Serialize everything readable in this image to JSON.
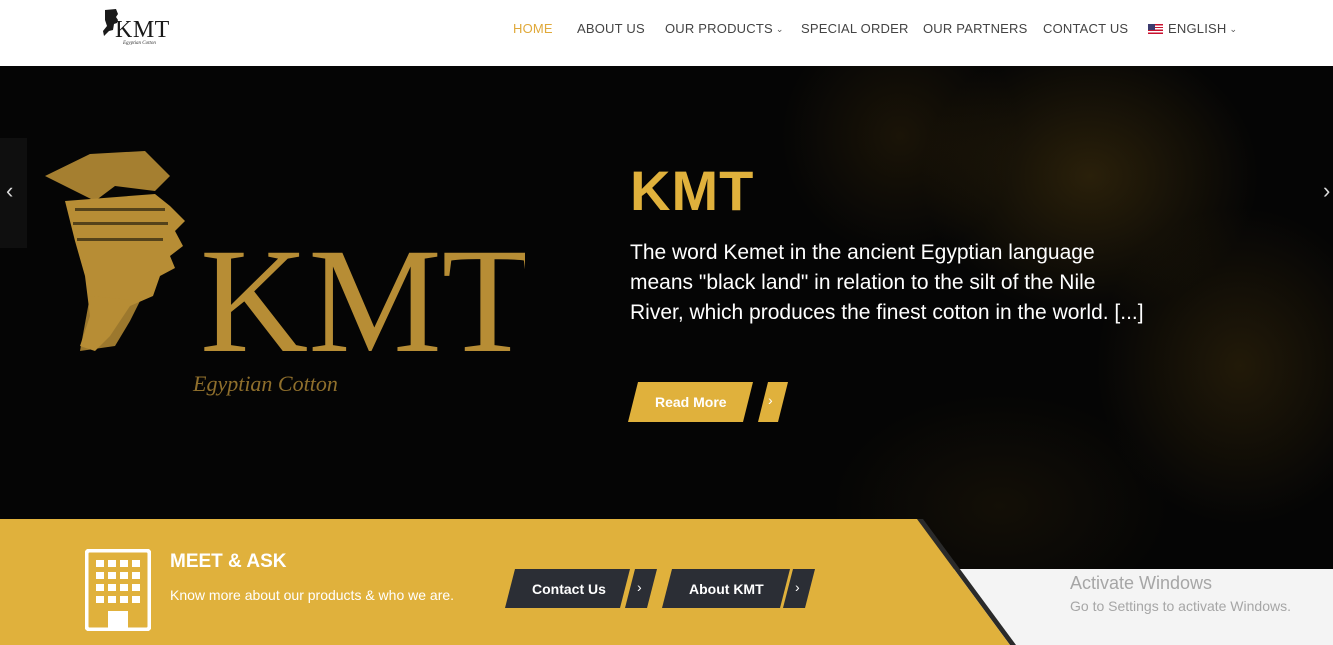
{
  "header": {
    "logo_text": "KMT",
    "logo_tagline": "Egyptian Cotton",
    "nav": [
      {
        "label": "HOME",
        "active": true
      },
      {
        "label": "ABOUT US"
      },
      {
        "label": "OUR PRODUCTS",
        "dropdown": true
      },
      {
        "label": "SPECIAL ORDER"
      },
      {
        "label": "OUR PARTNERS"
      },
      {
        "label": "CONTACT US"
      },
      {
        "label": "ENGLISH",
        "dropdown": true,
        "icon": "us-flag-icon"
      }
    ]
  },
  "hero": {
    "emblem_text": "KMT",
    "emblem_tagline": "Egyptian Cotton",
    "title": "KMT",
    "text": "The word Kemet in the ancient Egyptian language means \"black land\" in relation to the silt of the Nile River, which produces the finest cotton in the world. [...]",
    "read_more_label": "Read More",
    "arrow_glyph": "›",
    "prev_glyph": "‹",
    "next_glyph": "›"
  },
  "band": {
    "title": "MEET & ASK",
    "subtitle": "Know more about our products & who we are.",
    "contact_label": "Contact Us",
    "about_label": "About KMT",
    "arrow_glyph": "›",
    "icon": "building-icon"
  },
  "watermark": {
    "line1": "Activate Windows",
    "line2": "Go to Settings to activate Windows."
  },
  "colors": {
    "accent": "#e0b13c",
    "hero_bg": "#050505",
    "button_dark": "#2b2e35"
  }
}
